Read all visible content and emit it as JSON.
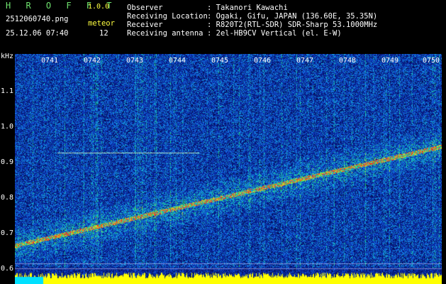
{
  "header": {
    "app_name": "H R O F F T",
    "version": "1.0.0",
    "filename": "2512060740.png",
    "meteor_label": "meteor",
    "meteor_count": "12",
    "datetime": "25.12.06 07:40",
    "info_keys": [
      "Observer",
      "Receiving Location",
      "Receiver",
      "Receiving antenna"
    ],
    "info_values": [
      ": Takanori Kawachi",
      ": Ogaki, Gifu, JAPAN (136.60E, 35.35N)",
      ": R820T2(RTL-SDR) SDR-Sharp 53.1000MHz",
      ": 2el-HB9CV Vertical (el. E-W)"
    ]
  },
  "axis": {
    "y_unit": "kHz",
    "y_ticks": [
      "1.1",
      "1.0",
      "0.9",
      "0.8",
      "0.7",
      "0.6"
    ],
    "x_ticks": [
      "0741",
      "0742",
      "0743",
      "0744",
      "0745",
      "0746",
      "0747",
      "0748",
      "0749",
      "0750"
    ]
  },
  "colors": {
    "background": "#000000",
    "header_text": "#ffffff",
    "title_text": "#6fe36f",
    "meta_text": "#ffff40",
    "spectrum_low": "#0a1a8c",
    "spectrum_mid": "#18c8c0",
    "spectrum_high": "#ff2020",
    "bottom_band": "#ffff00"
  }
}
